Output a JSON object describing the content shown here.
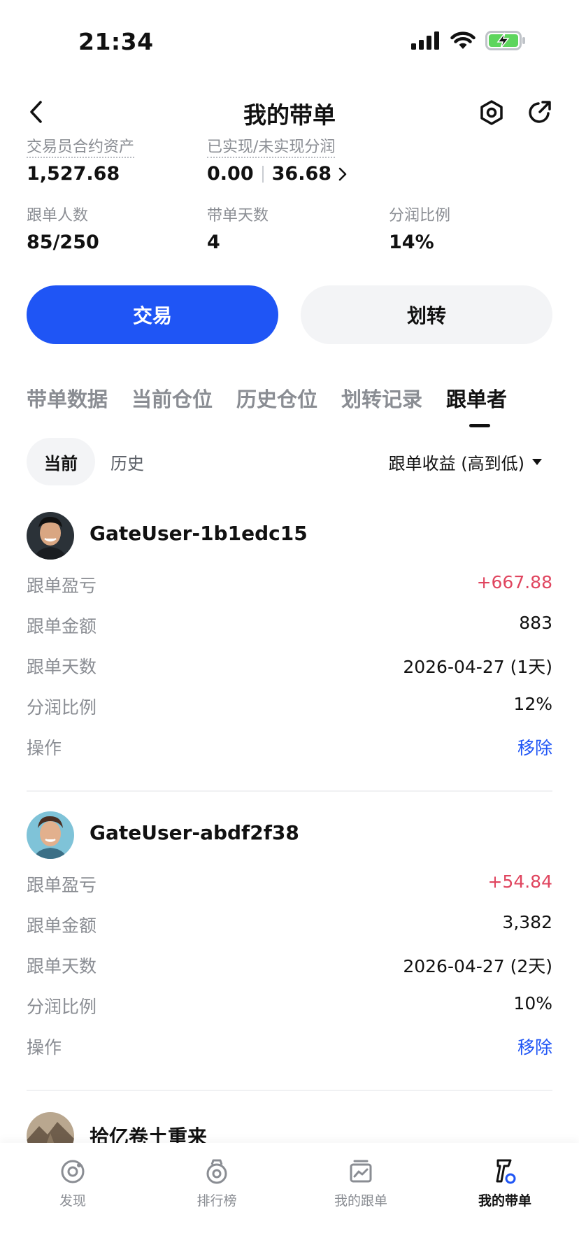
{
  "status_bar": {
    "time": "21:34"
  },
  "nav": {
    "title": "我的带单"
  },
  "stats": {
    "contract_assets_label": "交易员合约资产",
    "contract_assets_value": "1,527.68",
    "profit_share_label": "已实现/未实现分润",
    "realized_value": "0.00",
    "unrealized_value": "36.68",
    "followers_label": "跟单人数",
    "followers_value": "85/250",
    "days_label": "带单天数",
    "days_value": "4",
    "share_ratio_label": "分润比例",
    "share_ratio_value": "14%"
  },
  "actions": {
    "trade_label": "交易",
    "transfer_label": "划转"
  },
  "tabs": [
    {
      "label": "带单数据"
    },
    {
      "label": "当前仓位"
    },
    {
      "label": "历史仓位"
    },
    {
      "label": "划转记录"
    },
    {
      "label": "跟单者"
    }
  ],
  "active_tab": "跟单者",
  "filters": {
    "current_label": "当前",
    "history_label": "历史",
    "sort_label": "跟单收益 (高到低)"
  },
  "followers": [
    {
      "name": "GateUser-1b1edc15",
      "rows": [
        {
          "label": "跟单盈亏",
          "value": "+667.88"
        },
        {
          "label": "跟单金额",
          "value": "883"
        },
        {
          "label": "跟单天数",
          "value": "2026-04-27 (1天)"
        },
        {
          "label": "分润比例",
          "value": "12%"
        },
        {
          "label": "操作",
          "value": "移除"
        }
      ]
    },
    {
      "name": "GateUser-abdf2f38",
      "rows": [
        {
          "label": "跟单盈亏",
          "value": "+54.84"
        },
        {
          "label": "跟单金额",
          "value": "3,382"
        },
        {
          "label": "跟单天数",
          "value": "2026-04-27 (2天)"
        },
        {
          "label": "分润比例",
          "value": "10%"
        },
        {
          "label": "操作",
          "value": "移除"
        }
      ]
    },
    {
      "name": "拾亿卷土重来"
    }
  ],
  "bottom_nav": [
    {
      "label": "发现",
      "icon": "discover-icon"
    },
    {
      "label": "排行榜",
      "icon": "ranking-icon"
    },
    {
      "label": "我的跟单",
      "icon": "my-copy-icon"
    },
    {
      "label": "我的带单",
      "icon": "my-lead-icon"
    }
  ],
  "colors": {
    "accent": "#1f55f5",
    "positive": "#e0455f",
    "muted": "#8a8d93",
    "battery": "#5dd55d"
  }
}
